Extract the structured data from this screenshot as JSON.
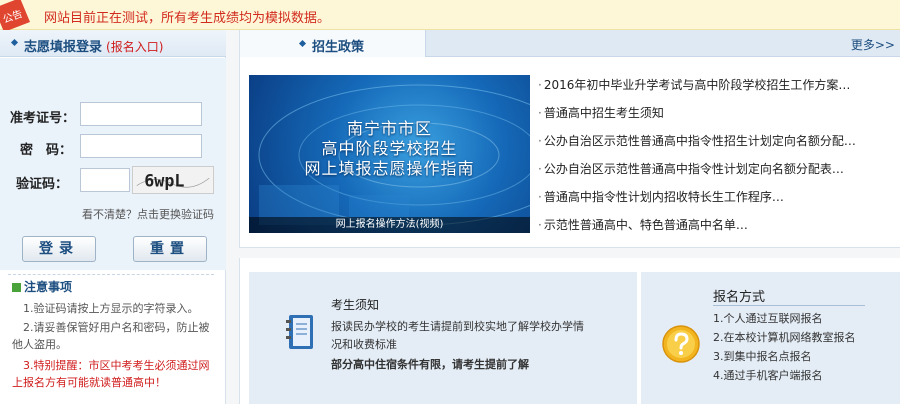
{
  "notice": {
    "badge": "公告",
    "text": "网站目前正在测试，所有考生成绩均为模拟数据。"
  },
  "login": {
    "title": "志愿填报登录",
    "subtitle": "(报名入口)",
    "exam_id_label": "准考证号：",
    "password_label": "密　码：",
    "captcha_label": "验证码：",
    "captcha_text": "6wpL",
    "refresh_captcha": "看不清楚？点击更换验证码",
    "login_button": "登录",
    "reset_button": "重置"
  },
  "notes": {
    "title": "注意事项",
    "items": [
      "　1.验证码请按上方显示的字符录入。",
      "　2.请妥善保管好用户名和密码，防止被他人盗用。",
      "　3.特别提醒：市区中考考生必须通过网上报名方有可能就读普通高中！"
    ]
  },
  "policy": {
    "tab": "招生政策",
    "more": "更多>>",
    "banner_lines": [
      "南宁市市区",
      "高中阶段学校招生",
      "网上填报志愿操作指南"
    ],
    "banner_caption": "网上报名操作方法(视频)",
    "news": [
      "2016年初中毕业升学考试与高中阶段学校招生工作方案…",
      "普通高中招生考生须知",
      "公办自治区示范性普通高中指令性招生计划定向名额分配…",
      "公办自治区示范性普通高中指令性计划定向名额分配表…",
      "普通高中指令性计划内招收特长生工作程序…",
      "示范性普通高中、特色普通高中名单…"
    ]
  },
  "guide": {
    "title": "考生须知",
    "text1": "报读民办学校的考生请提前到校实地了解学校办学情况和收费标准",
    "text2": "部分高中住宿条件有限，请考生提前了解"
  },
  "registration": {
    "title": "报名方式",
    "items": [
      "1.个人通过互联网报名",
      "2.在本校计算机网络教室报名",
      "3.到集中报名点报名",
      "4.通过手机客户端报名"
    ]
  },
  "colors": {
    "accent": "#1d4e80",
    "warning": "#d22b1e",
    "panel_bg": "#e4edf6"
  }
}
